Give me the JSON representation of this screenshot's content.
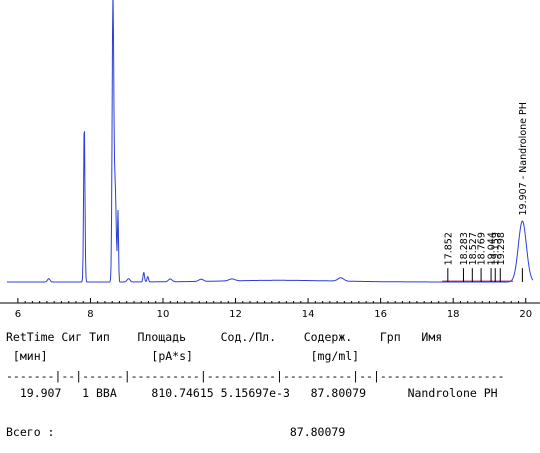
{
  "chart_data": {
    "type": "line",
    "xlim": [
      5.7,
      20.2
    ],
    "ylim": [
      0,
      1
    ],
    "x_ticks": [
      6,
      8,
      10,
      12,
      14,
      16,
      18,
      20
    ],
    "trace_color": "#2b3fd6",
    "baseline_color": "#b0108a",
    "trace_peaks": [
      {
        "rt": 6.85,
        "h": 0.012,
        "w": 0.035
      },
      {
        "rt": 7.83,
        "h": 0.58,
        "w": 0.018
      },
      {
        "rt": 8.62,
        "h": 1.0,
        "w": 0.022
      },
      {
        "rt": 8.68,
        "h": 0.35,
        "w": 0.03
      },
      {
        "rt": 8.76,
        "h": 0.25,
        "w": 0.014
      },
      {
        "rt": 9.05,
        "h": 0.012,
        "w": 0.04
      },
      {
        "rt": 9.47,
        "h": 0.035,
        "w": 0.02
      },
      {
        "rt": 9.58,
        "h": 0.02,
        "w": 0.02
      },
      {
        "rt": 10.2,
        "h": 0.01,
        "w": 0.05
      },
      {
        "rt": 11.05,
        "h": 0.008,
        "w": 0.06
      },
      {
        "rt": 11.9,
        "h": 0.007,
        "w": 0.08
      },
      {
        "rt": 14.9,
        "h": 0.012,
        "w": 0.08
      },
      {
        "rt": 19.907,
        "h": 0.22,
        "w": 0.11
      }
    ],
    "peak_labels": [
      {
        "rt": 17.852,
        "label": "17.852"
      },
      {
        "rt": 18.283,
        "label": "18.283"
      },
      {
        "rt": 18.527,
        "label": "18.527"
      },
      {
        "rt": 18.769,
        "label": "18.769"
      },
      {
        "rt": 19.044,
        "label": "19.044"
      },
      {
        "rt": 19.159,
        "label": "19.159"
      },
      {
        "rt": 19.298,
        "label": "19.298"
      },
      {
        "rt": 19.907,
        "label": "19.907 - Nandrolone PH"
      }
    ]
  },
  "report": {
    "header_row": "RetTime Сиг Тип    Площадь     Сод./Пл.    Содерж.    Грп   Имя",
    "units_row": " [мин]               [pA*s]                 [mg/ml]",
    "separator_row": "-------|--|------|----------|----------|----------|--|------------------",
    "data_rows": [
      "  19.907   1 BBA     810.74615 5.15697e-3   87.80079      Nandrolone PH"
    ],
    "total_row": "Всего :                                  87.80079"
  }
}
